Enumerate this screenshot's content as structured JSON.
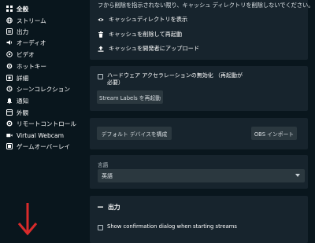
{
  "sidebar": {
    "items": [
      {
        "label": "全般",
        "icon": "settings-grid-icon",
        "active": true
      },
      {
        "label": "ストリーム",
        "icon": "globe-icon"
      },
      {
        "label": "出力",
        "icon": "output-icon"
      },
      {
        "label": "オーディオ",
        "icon": "speaker-icon"
      },
      {
        "label": "ビデオ",
        "icon": "video-icon"
      },
      {
        "label": "ホットキー",
        "icon": "keyboard-icon"
      },
      {
        "label": "詳細",
        "icon": "advanced-icon"
      },
      {
        "label": "シーンコレクション",
        "icon": "collection-icon"
      },
      {
        "label": "通知",
        "icon": "bell-icon"
      },
      {
        "label": "外観",
        "icon": "appearance-icon"
      },
      {
        "label": "リモートコントロール",
        "icon": "remote-icon"
      },
      {
        "label": "Virtual Webcam",
        "icon": "webcam-icon"
      },
      {
        "label": "ゲームオーバーレイ",
        "icon": "overlay-icon"
      }
    ]
  },
  "main": {
    "top_text": "フから削除を指示されない限り、キャッシュ ディレクトリを削除しないでください。",
    "cache_links": [
      {
        "label": "キャッシュディレクトリを表示",
        "icon": "eye-icon"
      },
      {
        "label": "キャッシュを削除して再起動",
        "icon": "trash-icon"
      },
      {
        "label": "キャッシュを開発者にアップロード",
        "icon": "upload-icon"
      }
    ],
    "hw_accel_label": "ハードウェア アクセラレーションの無効化 （再起動が必要）",
    "hw_accel_label_line1": "ハードウェア アクセラレーションの無効化 （再起動が",
    "hw_accel_label_line2": "必要）",
    "restart_stream_labels": "Stream Labels を再起動",
    "configure_default_devices": "デフォルト デバイスを構成",
    "obs_import": "OBS インポート",
    "language_label": "言語",
    "language_value": "英語",
    "output_section_title": "出力",
    "confirm_dialog_label": "Show confirmation dialog when starting streams"
  },
  "colors": {
    "background": "#09161d",
    "card": "#17242d",
    "button": "#2b383f",
    "arrow": "#d92b2b"
  }
}
